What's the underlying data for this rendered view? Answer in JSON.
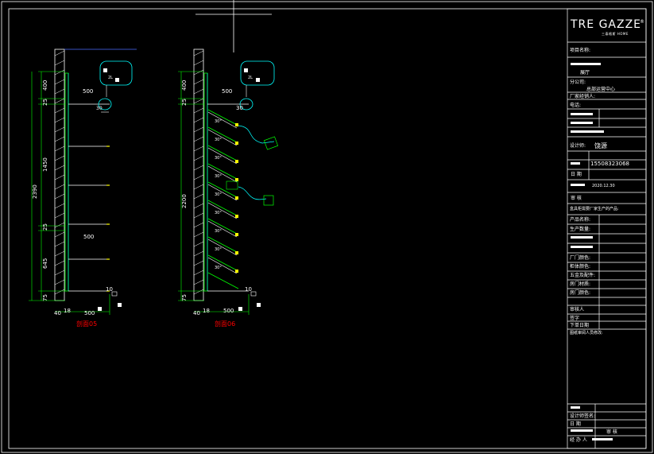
{
  "brand": {
    "name": "TRE GAZZE",
    "sub": "三泰格斯 HOME",
    "mark": "®"
  },
  "drawings": {
    "left_caption": "剖面05",
    "right_caption": "剖面06",
    "left_dims": {
      "top": "400",
      "d25a": "25",
      "d1450": "1450",
      "d25b": "25",
      "d645": "645",
      "d75": "75",
      "total": "2390",
      "w500a": "500",
      "w500b": "500",
      "w500c": "500",
      "r30": "30",
      "base10": "10",
      "b40": "40",
      "b18": "18"
    },
    "right_dims": {
      "top": "400",
      "d25": "25",
      "d2200": "2200",
      "d75": "75",
      "w500a": "500",
      "w500b": "500",
      "r30": "30",
      "base10": "10",
      "b40": "40",
      "b18": "18",
      "angle": "30°"
    },
    "bubble_text": "2L"
  },
  "title_block": {
    "project_label": "项目名称:",
    "hall": "展厅",
    "company_label": "分公司:",
    "company_value": "总部运营中心",
    "factory_label": "厂家经销人:",
    "phone_label": "电话:",
    "designer_label": "设计师:",
    "designer_value": "饶源",
    "phone_value": "15508323068",
    "date_label": "日 期",
    "date_value": "2020.12.30",
    "review_label": "审 核",
    "product_label": "盒具柜需要厂家生产的产品:",
    "rows": [
      "产品名称:",
      "生产数量:",
      "",
      "",
      "厂门颜色:",
      "柜体颜色:",
      "五金及配件:",
      "房门材质:",
      "房门颜色:"
    ],
    "confirm_label": "审核人",
    "sign_label": "签字",
    "order_date_label": "下单日期",
    "note_label": "图纸审阅人员修改:",
    "bottom_rows": [
      "",
      "设计师签名:",
      "日 期",
      "",
      "经 办 人"
    ],
    "bottom_right": "审 核"
  }
}
